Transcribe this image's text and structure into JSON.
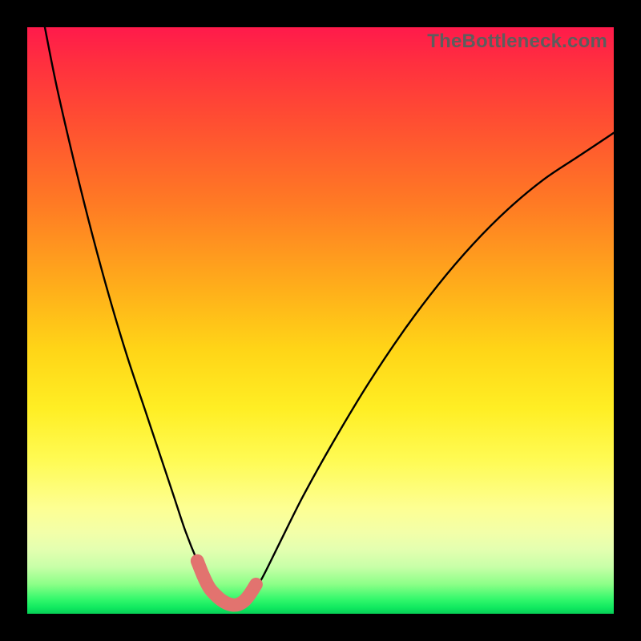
{
  "watermark": "TheBottleneck.com",
  "colors": {
    "background": "#000000",
    "curve": "#000000",
    "marker": "#e2736f",
    "gradient_top": "#ff1a4b",
    "gradient_bottom": "#08cf57"
  },
  "chart_data": {
    "type": "line",
    "title": "",
    "xlabel": "",
    "ylabel": "",
    "xlim": [
      0,
      100
    ],
    "ylim": [
      0,
      100
    ],
    "grid": false,
    "legend": false,
    "series": [
      {
        "name": "bottleneck-curve",
        "x": [
          3,
          5,
          8,
          11,
          14,
          17,
          20,
          23,
          25,
          27,
          29,
          30.5,
          32,
          33,
          34,
          35,
          36,
          37,
          38,
          40,
          43,
          47,
          52,
          58,
          64,
          70,
          76,
          82,
          88,
          94,
          100
        ],
        "y": [
          100,
          90,
          77,
          65,
          54,
          44,
          35,
          26,
          20,
          14,
          9,
          6,
          3.5,
          2.3,
          1.7,
          1.4,
          1.5,
          2.0,
          3.0,
          6,
          12,
          20,
          29,
          39,
          48,
          56,
          63,
          69,
          74,
          78,
          82
        ]
      }
    ],
    "markers": {
      "name": "optimal-range",
      "x": [
        29,
        30,
        31,
        32,
        33,
        34,
        35,
        36,
        37,
        38,
        39
      ],
      "y": [
        9,
        6.5,
        4.5,
        3.3,
        2.4,
        1.8,
        1.5,
        1.6,
        2.2,
        3.4,
        5
      ],
      "color": "#e2736f",
      "size": 14
    },
    "annotations": []
  }
}
